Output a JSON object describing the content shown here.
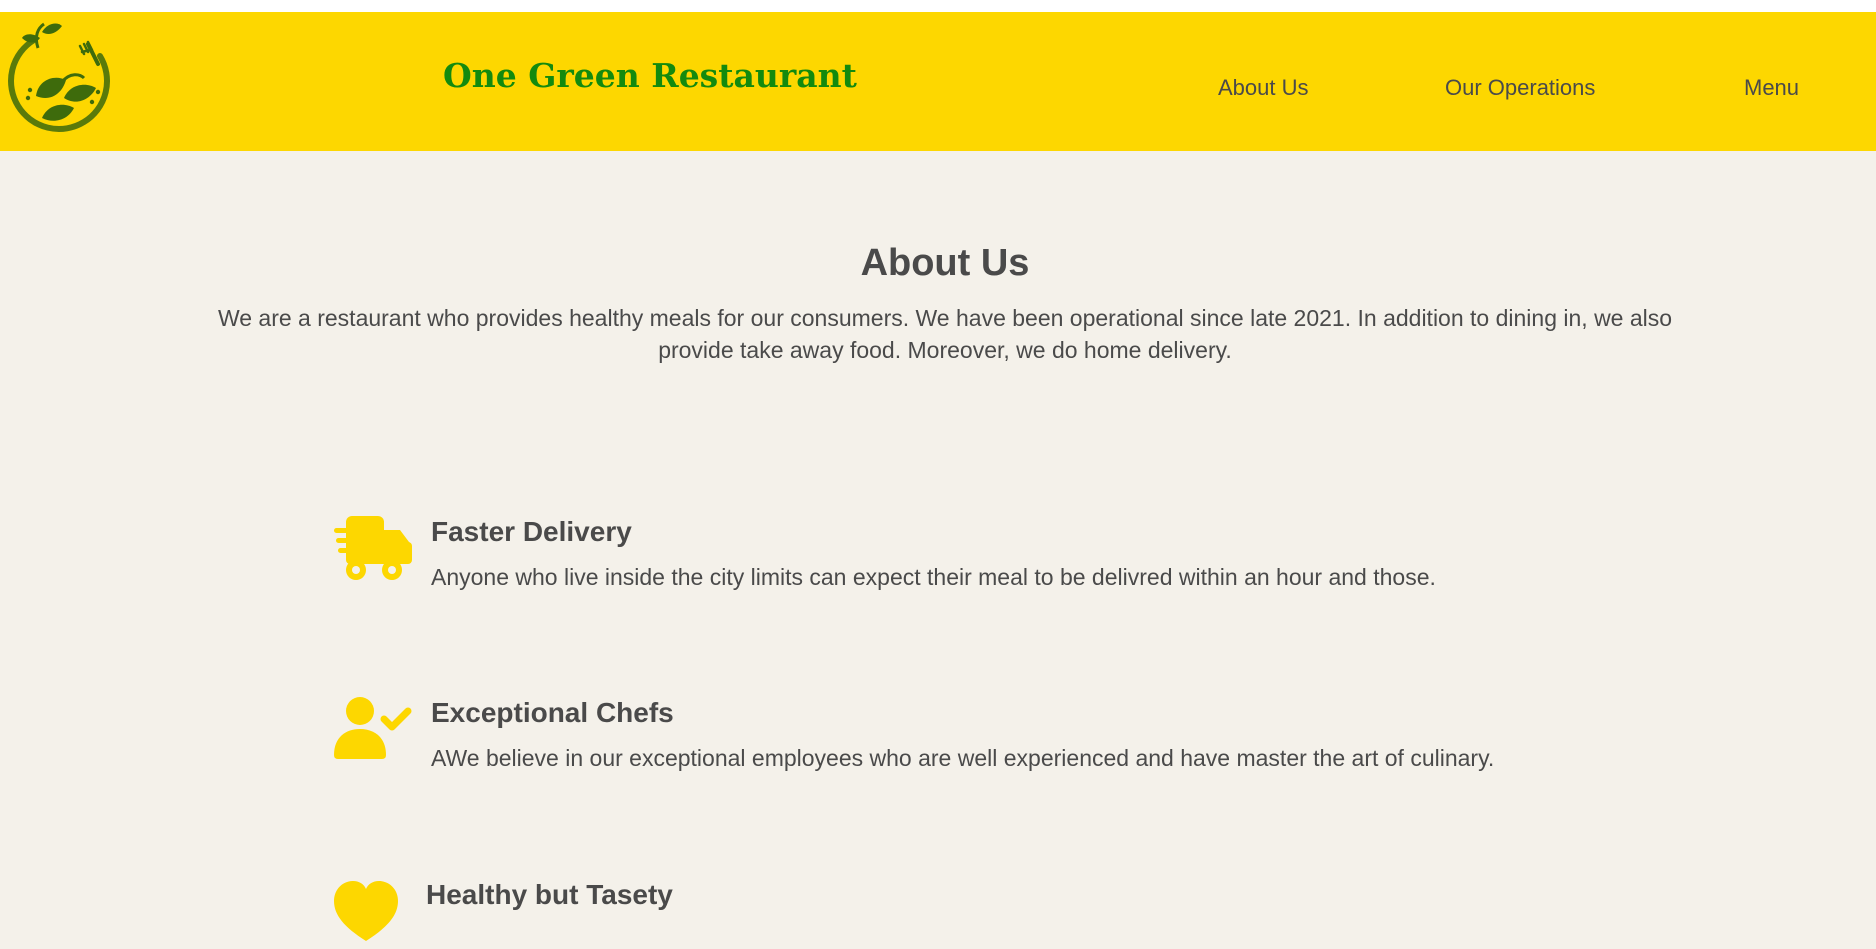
{
  "header": {
    "title": "One Green Restaurant",
    "logo_icon": "leaf-fork-plate-logo",
    "nav": [
      {
        "label": "About Us"
      },
      {
        "label": "Our Operations"
      },
      {
        "label": "Menu"
      }
    ]
  },
  "about": {
    "title": "About Us",
    "description": "We are a restaurant who provides healthy meals for our consumers. We have been operational since late 2021. In addition to dining in, we also provide take away food. Moreover, we do home delivery."
  },
  "features": [
    {
      "icon": "delivery-truck-icon",
      "title": "Faster Delivery",
      "description": "Anyone who live inside the city limits can expect their meal to be delivred within an hour and those."
    },
    {
      "icon": "user-check-icon",
      "title": "Exceptional Chefs",
      "description": "AWe believe in our exceptional employees who are well experienced and have master the art of culinary."
    },
    {
      "icon": "heart-icon",
      "title": "Healthy but Tasety",
      "description": ""
    }
  ],
  "colors": {
    "header_bg": "#fdd700",
    "title_green": "#138a0e",
    "page_bg": "#f4f1ea",
    "text": "#4a4a4a",
    "icon_yellow": "#fdd700"
  }
}
